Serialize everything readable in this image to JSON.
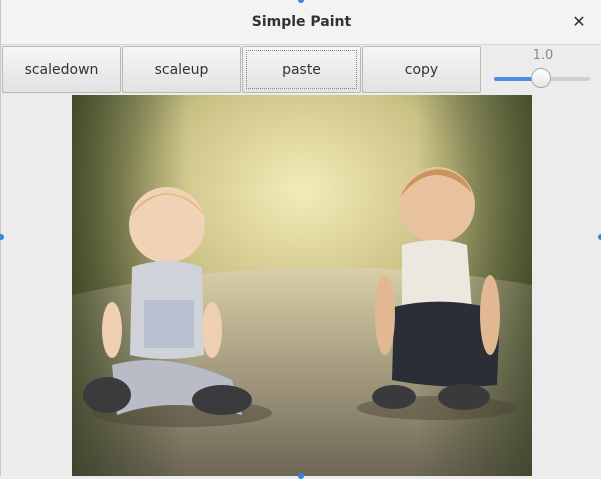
{
  "window": {
    "title": "Simple Paint"
  },
  "toolbar": {
    "buttons": [
      {
        "label": "scaledown"
      },
      {
        "label": "scaleup"
      },
      {
        "label": "paste"
      },
      {
        "label": "copy"
      }
    ],
    "scale": {
      "value_text": "1.0",
      "fraction": 0.5
    }
  },
  "icons": {
    "close": "close-icon"
  },
  "colors": {
    "accent": "#3584e4",
    "slider_fill": "#4a90d9"
  }
}
